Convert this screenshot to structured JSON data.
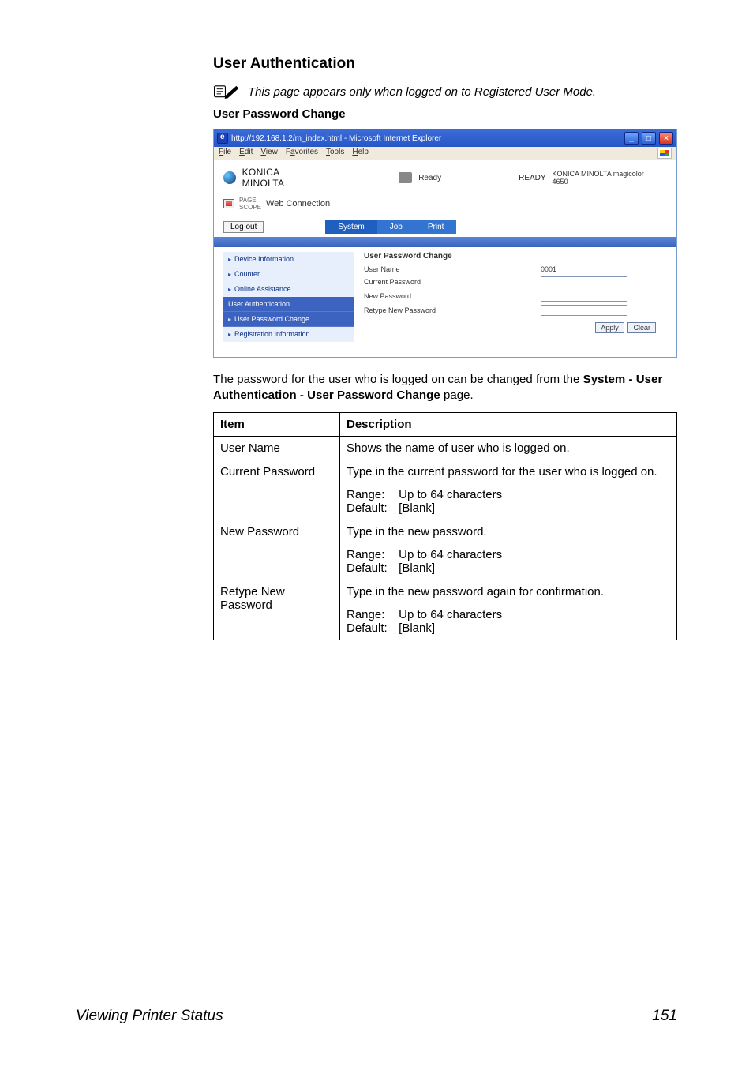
{
  "headings": {
    "h2": "User Authentication",
    "note": "This page appears only when logged on to Registered User Mode.",
    "h3": "User Password Change"
  },
  "browser": {
    "title": "http://192.168.1.2/m_index.html - Microsoft Internet Explorer",
    "menus": {
      "file": "File",
      "edit": "Edit",
      "view": "View",
      "favorites": "Favorites",
      "tools": "Tools",
      "help": "Help"
    },
    "ctl": {
      "min": "_",
      "max": "□",
      "close": "×"
    },
    "brand": "KONICA MINOLTA",
    "status_label": "Ready",
    "status_center": "READY",
    "model": "KONICA MINOLTA magicolor 4650",
    "pagescope_small1": "PAGE",
    "pagescope_small2": "SCOPE",
    "webconn": "Web Connection",
    "logout": "Log out",
    "tabs": {
      "system": "System",
      "job": "Job",
      "print": "Print"
    },
    "side": {
      "device": "Device Information",
      "counter": "Counter",
      "online": "Online Assistance",
      "userauth": "User Authentication",
      "upw": "User Password Change",
      "reg": "Registration Information"
    },
    "panel": {
      "title": "User Password Change",
      "uname_label": "User Name",
      "uname_val": "0001",
      "cur_label": "Current Password",
      "new_label": "New Password",
      "re_label": "Retype New Password",
      "apply": "Apply",
      "clear": "Clear"
    }
  },
  "para": {
    "p1a": "The password for the user who is logged on can be changed from the ",
    "p1b": "System - User Authentication - User Password Change",
    "p1c": " page."
  },
  "table": {
    "h_item": "Item",
    "h_desc": "Description",
    "r1_item": "User Name",
    "r1_desc": "Shows the name of user who is logged on.",
    "r2_item": "Current Password",
    "r2_desc": "Type in the current password for the user who is logged on.",
    "r3_item": "New Password",
    "r3_desc": "Type in the new password.",
    "r4_item": "Retype New Password",
    "r4_desc": "Type in the new password again for confirmation.",
    "range_lbl": "Range:",
    "range_val": "Up to 64 characters",
    "default_lbl": "Default:",
    "default_val": "[Blank]"
  },
  "footer": {
    "title": "Viewing Printer Status",
    "page": "151"
  }
}
